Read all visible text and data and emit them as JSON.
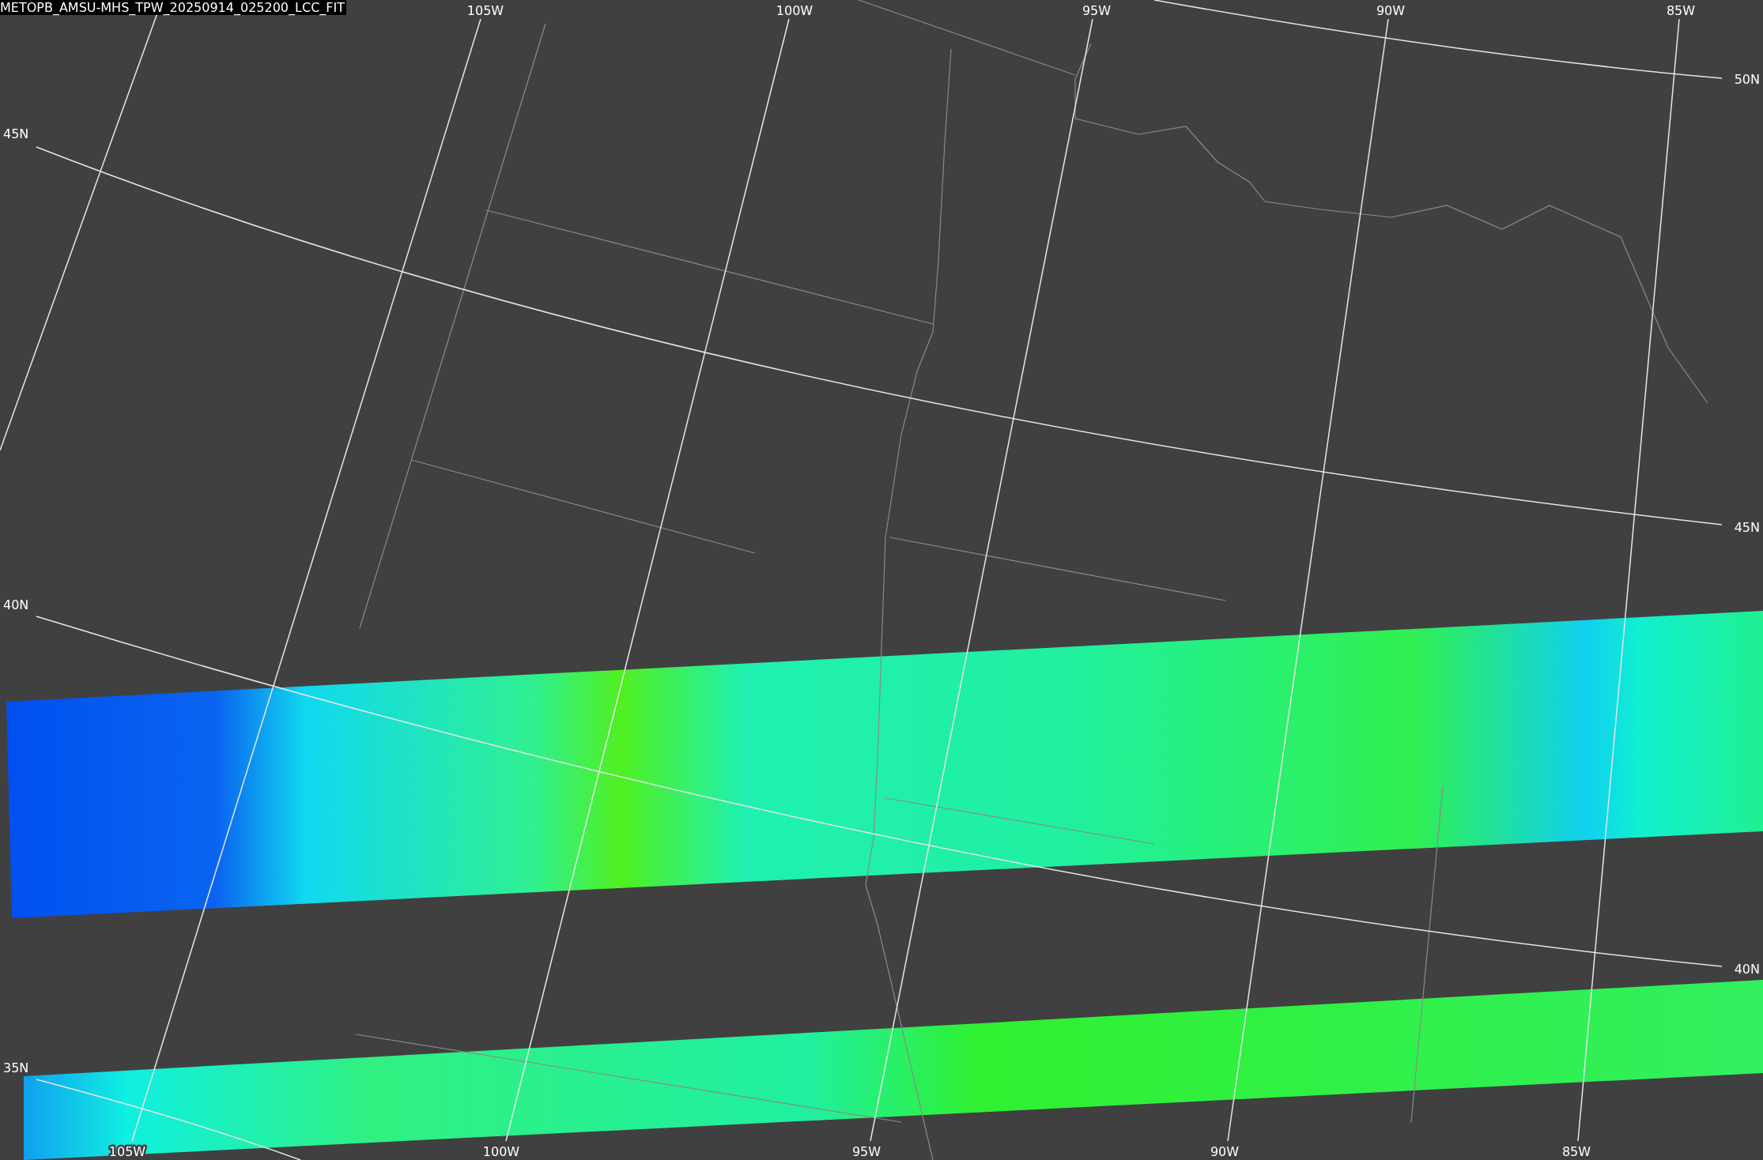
{
  "title": "METOPB_AMSU-MHS_TPW_20250914_025200_LCC_FIT",
  "lon_labels_top": [
    "105W",
    "100W",
    "95W",
    "90W",
    "85W"
  ],
  "lon_labels_bottom": [
    "105W",
    "100W",
    "95W",
    "90W",
    "85W"
  ],
  "lat_labels_left": [
    "45N",
    "40N",
    "35N"
  ],
  "lat_labels_right": [
    "50N",
    "45N",
    "40N"
  ]
}
